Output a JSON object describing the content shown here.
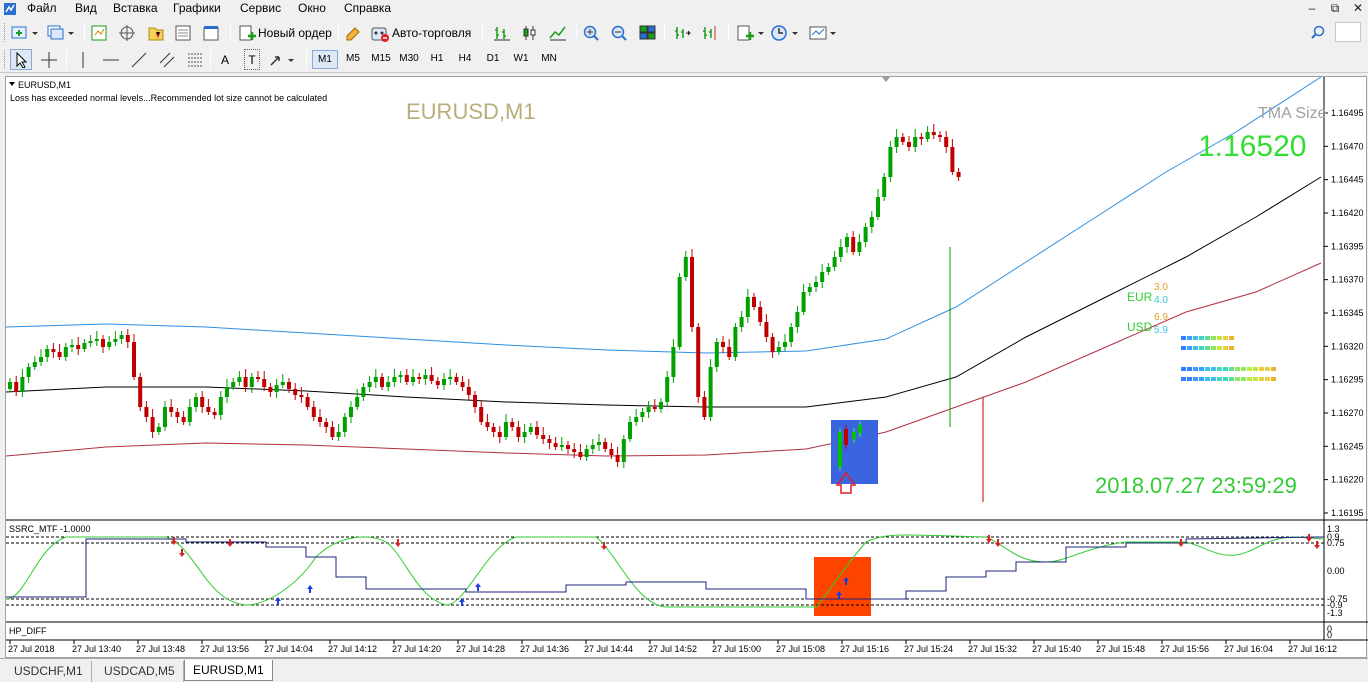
{
  "menu": {
    "items": [
      "Файл",
      "Вид",
      "Вставка",
      "Графики",
      "Сервис",
      "Окно",
      "Справка"
    ]
  },
  "toolbar": {
    "new_order_label": "Новый ордер",
    "autotrading_label": "Авто-торговля",
    "timeframes": [
      "M1",
      "M5",
      "M15",
      "M30",
      "H1",
      "H4",
      "D1",
      "W1",
      "MN"
    ],
    "active_timeframe": "M1",
    "letter_tools": [
      "A",
      "T"
    ]
  },
  "chart": {
    "window_title": "EURUSD,M1",
    "warning": "Loss has exceeded normal levels...Recommended lot size cannot be calculated",
    "watermark": "EURUSD,M1",
    "big_price": "1.16520",
    "tma_label": "TMA Size",
    "datetime_text": "2018.07.27 23:59:29",
    "currency_labels": {
      "eur": "EUR",
      "usd": "USD",
      "eur_v1": "3.0",
      "eur_v2": "4.0",
      "usd_v1": "6.9",
      "usd_v2": "5.9"
    },
    "price_axis": [
      "1.16495",
      "1.16470",
      "1.16445",
      "1.16420",
      "1.16395",
      "1.16370",
      "1.16345",
      "1.16320",
      "1.16295",
      "1.16270",
      "1.16245",
      "1.16220",
      "1.16195"
    ],
    "time_axis": [
      "27 Jul 2018",
      "27 Jul 13:40",
      "27 Jul 13:48",
      "27 Jul 13:56",
      "27 Jul 14:04",
      "27 Jul 14:12",
      "27 Jul 14:20",
      "27 Jul 14:28",
      "27 Jul 14:36",
      "27 Jul 14:44",
      "27 Jul 14:52",
      "27 Jul 15:00",
      "27 Jul 15:08",
      "27 Jul 15:16",
      "27 Jul 15:24",
      "27 Jul 15:32",
      "27 Jul 15:40",
      "27 Jul 15:48",
      "27 Jul 15:56",
      "27 Jul 16:04",
      "27 Jul 16:12"
    ],
    "indicator1_title": "SSRC_MTF -1.0000",
    "indicator1_axis": [
      "1.3",
      "0.9",
      "0.75",
      "0.00",
      "-0.75",
      "-0.9",
      "-1.3"
    ],
    "indicator2_title": "HP_DIFF",
    "indicator2_axis": [
      "0",
      "0"
    ]
  },
  "colors": {
    "bull_candle": "#00a000",
    "bear_candle": "#c00000",
    "tma_upper": "#2f8fe0",
    "tma_mid": "#000000",
    "tma_lower": "#b03040",
    "ssrc_line": "#33cc33",
    "ssrc_slow": "#1a237e",
    "highlight_blue": "#3a64e0",
    "highlight_orange": "#ff4400",
    "big_price_green": "#33dd33",
    "watermark_color": "#b8ae7a"
  },
  "tabs": [
    "USDCHF,M1",
    "USDCAD,M5",
    "EURUSD,M1"
  ],
  "active_tab": "EURUSD,M1"
}
